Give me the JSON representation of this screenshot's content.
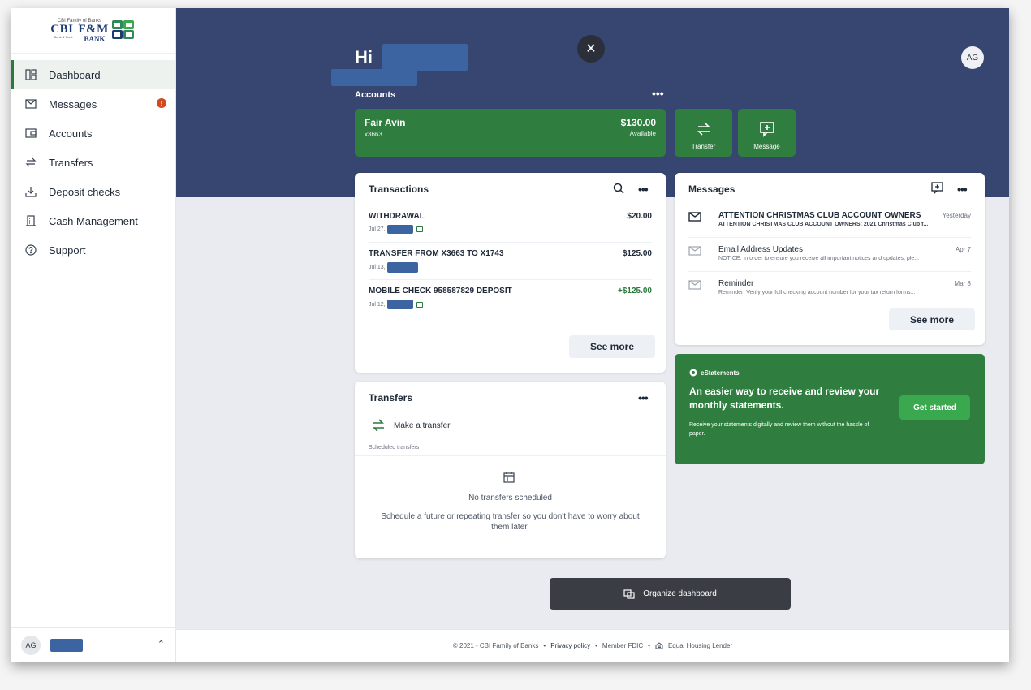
{
  "brand": {
    "tagline": "CBI Family of Banks",
    "name_left": "CBI",
    "name_right_top": "F&M",
    "name_right_bottom": "BANK",
    "small_left": "Bank & Trust",
    "brand_color": "#2b7a3d"
  },
  "sidebar": {
    "items": [
      {
        "label": "Dashboard",
        "icon": "dashboard-icon",
        "active": true
      },
      {
        "label": "Messages",
        "icon": "mail-icon",
        "badge": "!"
      },
      {
        "label": "Accounts",
        "icon": "wallet-icon"
      },
      {
        "label": "Transfers",
        "icon": "transfer-icon"
      },
      {
        "label": "Deposit checks",
        "icon": "deposit-icon"
      },
      {
        "label": "Cash Management",
        "icon": "building-icon"
      },
      {
        "label": "Support",
        "icon": "help-icon"
      }
    ],
    "user_initials": "AG"
  },
  "header": {
    "greeting": "Hi",
    "avatar_initials": "AG"
  },
  "accounts": {
    "title": "Accounts",
    "card": {
      "name": "Fair Avin",
      "number": "x3663",
      "amount": "$130.00",
      "amount_label": "Available"
    },
    "actions": [
      {
        "label": "Transfer",
        "icon": "transfer-icon"
      },
      {
        "label": "Message",
        "icon": "message-add-icon"
      }
    ]
  },
  "transactions": {
    "title": "Transactions",
    "rows": [
      {
        "desc": "WITHDRAWAL",
        "date": "Jul 27,",
        "amount": "$20.00",
        "positive": false,
        "has_image": true
      },
      {
        "desc": "TRANSFER FROM X3663 TO X1743",
        "date": "Jul 13,",
        "amount": "$125.00",
        "positive": false,
        "has_image": false
      },
      {
        "desc": "MOBILE CHECK 958587829 DEPOSIT",
        "date": "Jul 12,",
        "amount": "+$125.00",
        "positive": true,
        "has_image": true
      }
    ],
    "see_more": "See more"
  },
  "messages": {
    "title": "Messages",
    "rows": [
      {
        "subject": "ATTENTION CHRISTMAS CLUB ACCOUNT OWNERS",
        "preview": "ATTENTION CHRISTMAS CLUB ACCOUNT OWNERS: 2021 Christmas Club f...",
        "date": "Yesterday",
        "unread": true
      },
      {
        "subject": "Email Address Updates",
        "preview": "NOTICE: In order to ensure you receive all important notices and updates, ple...",
        "date": "Apr 7",
        "unread": false
      },
      {
        "subject": "Reminder",
        "preview": "Reminder! Verify your full checking account number for your tax return forms...",
        "date": "Mar 8",
        "unread": false
      }
    ],
    "see_more": "See more"
  },
  "estatements": {
    "tag": "eStatements",
    "headline": "An easier way to receive and review your monthly statements.",
    "body": "Receive your statements digitally and review them without the hassle of paper.",
    "cta": "Get started"
  },
  "transfers": {
    "title": "Transfers",
    "make": "Make a transfer",
    "scheduled_label": "Scheduled transfers",
    "empty_title": "No transfers scheduled",
    "empty_desc": "Schedule a future or repeating transfer so you don't have to worry about them later."
  },
  "organize": {
    "label": "Organize dashboard"
  },
  "footer": {
    "copyright": "© 2021 - CBI Family of Banks",
    "privacy": "Privacy policy",
    "fdic": "Member FDIC",
    "housing": "Equal Housing Lender"
  }
}
